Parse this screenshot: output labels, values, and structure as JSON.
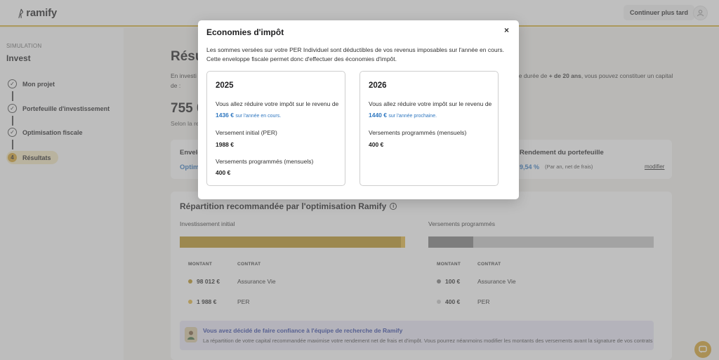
{
  "header": {
    "brand": "ramify",
    "later_label": "Continuer plus tard",
    "accent_color": "#d8b23a"
  },
  "sidebar": {
    "section_label": "SIMULATION",
    "title": "Invest",
    "steps": [
      {
        "label": "Mon projet",
        "state": "done"
      },
      {
        "label": "Portefeuille d'investissement",
        "state": "done"
      },
      {
        "label": "Optimisation fiscale",
        "state": "done"
      },
      {
        "label": "Résultats",
        "number": "4",
        "state": "active"
      }
    ]
  },
  "main": {
    "title": "Résu",
    "intro_left": "En investi",
    "intro_left2": "de :",
    "intro_right_a": "ne durée de ",
    "intro_right_b": "+ de 20 ans",
    "intro_right_c": ", vous pouvez constituer un capital",
    "amount": "755 0",
    "selon": "Selon la re",
    "envelope_label": "Envelo",
    "envelope_value": "Optim",
    "rendement_label": "Rendement du portefeuille",
    "rendement_value": "9,54 %",
    "rendement_sub": "(Par an, net de frais)",
    "modifier_label": "modifier",
    "repartition": {
      "title": "Répartition recommandée par l'optimisation Ramify",
      "initial_title": "Investissement initial",
      "monthly_title": "Versements programmés",
      "col_amount": "MONTANT",
      "col_contract": "CONTRAT",
      "initial_rows": [
        {
          "amount": "98 012 €",
          "contract": "Assurance  Vie",
          "color": "#b8901e"
        },
        {
          "amount": "1 988 €",
          "contract": "PER",
          "color": "#e2b43c"
        }
      ],
      "monthly_rows": [
        {
          "amount": "100 €",
          "contract": "Assurance  Vie",
          "color": "#7a7a7a"
        },
        {
          "amount": "400 €",
          "contract": "PER",
          "color": "#c6c6c6"
        }
      ],
      "initial_split": [
        0.98,
        0.02
      ],
      "monthly_split": [
        0.2,
        0.8
      ]
    },
    "trust": {
      "title": "Vous avez décidé de faire confiance à l'équipe de recherche de Ramify",
      "text": "La répartition de votre capital recommandée maximise votre rendement net de frais et d'impôt. Vous pourrez néanmoins modifier les montants des versements avant la signature de vos contrats"
    }
  },
  "modal": {
    "title": "Economies d'impôt",
    "close_symbol": "×",
    "description_1": "Les sommes versées sur votre PER Individuel sont déductibles de vos revenus imposables sur l'année en cours.",
    "description_2": "Cette enveloppe fiscale permet donc d'effectuer des économies d'impôt.",
    "cards": [
      {
        "year": "2025",
        "reduce_label": "Vous allez réduire votre impôt sur le revenu de",
        "reduce_amount": "1436 €",
        "reduce_suffix": "sur l'année en cours.",
        "initial_label": "Versement initial (PER)",
        "initial_value": "1988 €",
        "monthly_label": "Versements programmés (mensuels)",
        "monthly_value": "400 €"
      },
      {
        "year": "2026",
        "reduce_label": "Vous allez réduire votre impôt sur le revenu de",
        "reduce_amount": "1440 €",
        "reduce_suffix": "sur l'année prochaine.",
        "monthly_label": "Versements programmés (mensuels)",
        "monthly_value": "400 €"
      }
    ]
  }
}
